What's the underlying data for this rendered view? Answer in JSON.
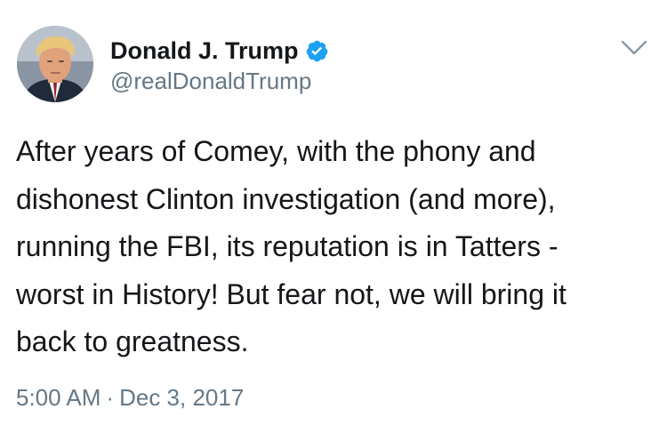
{
  "author": {
    "display_name": "Donald J. Trump",
    "handle": "@realDonaldTrump",
    "verified": true,
    "avatar_icon": "avatar-portrait"
  },
  "header": {
    "menu_icon": "chevron-down-icon"
  },
  "tweet": {
    "text_lines": [
      "After years of Comey, with the phony and",
      "dishonest Clinton investigation (and more),",
      "running the FBI, its reputation is in Tatters -",
      "worst in History! But fear not, we will bring it",
      "back to greatness."
    ],
    "time": "5:00 AM",
    "separator": "·",
    "date": "Dec 3, 2017"
  },
  "colors": {
    "text": "#14171a",
    "secondary": "#657786",
    "verified_blue": "#1da1f2",
    "background": "#ffffff"
  }
}
